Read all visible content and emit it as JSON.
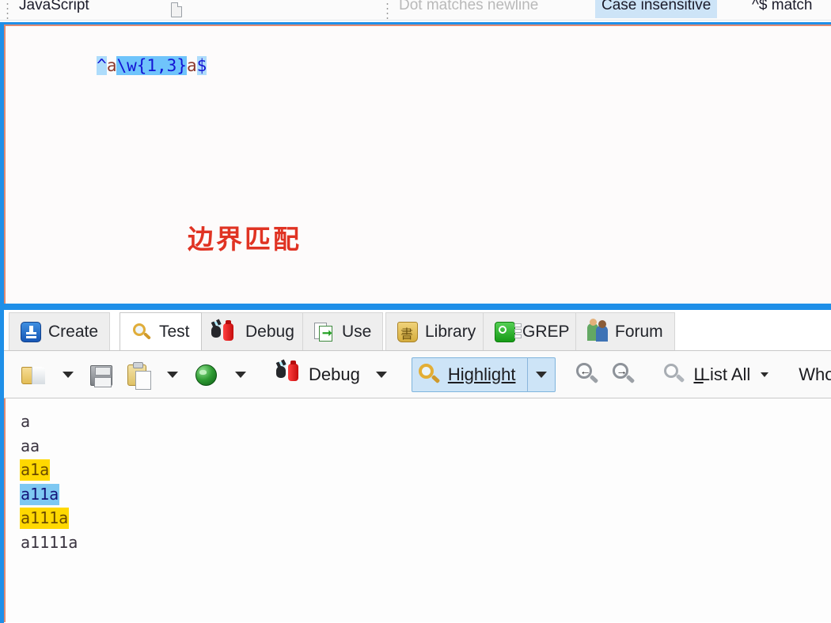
{
  "top_options_bar": {
    "flavor_label": "JavaScript",
    "page_icon_name": "page-icon",
    "options": [
      {
        "label": "Dot matches newline",
        "state": "disabled"
      },
      {
        "label": "Case insensitive",
        "state": "active"
      },
      {
        "label": "^$ match",
        "state": "normal"
      }
    ]
  },
  "regex_editor": {
    "tokens": [
      {
        "text": "^",
        "kind": "anchor"
      },
      {
        "text": "a",
        "kind": "literal"
      },
      {
        "text": "\\w{1,3}",
        "kind": "class"
      },
      {
        "text": "a",
        "kind": "literal"
      },
      {
        "text": "$",
        "kind": "anchor"
      }
    ],
    "full_pattern": "^a\\w{1,3}a$",
    "annotation": "边界匹配",
    "annotation_color": "#e03323"
  },
  "tabs": [
    {
      "label": "Create",
      "icon": "create-icon",
      "active": false
    },
    {
      "label": "Test",
      "icon": "magnifier-icon",
      "active": true
    },
    {
      "label": "Debug",
      "icon": "debug-bug-icon",
      "active": false
    },
    {
      "label": "Use",
      "icon": "use-page-icon",
      "active": false
    },
    {
      "label": "Library",
      "icon": "library-icon",
      "active": false
    },
    {
      "label": "GREP",
      "icon": "grep-icon",
      "active": false
    },
    {
      "label": "Forum",
      "icon": "forum-people-icon",
      "active": false
    }
  ],
  "toolbar": {
    "open_label": "",
    "save_label": "",
    "paste_label": "",
    "browser_label": "",
    "debug_label": "Debug",
    "highlight_label": "Highlight",
    "highlight_active": true,
    "find_prev_label": "",
    "find_next_label": "",
    "list_all_label": "List All",
    "whole_file_label": "Whole file",
    "icons": {
      "open": "open-folder-icon",
      "save": "floppy-save-icon",
      "paste": "clipboard-paste-icon",
      "browser": "globe-icon",
      "debug": "debug-bug-icon",
      "highlight": "magnifier-gold-icon",
      "find_prev": "magnifier-left-arrow-icon",
      "find_next": "magnifier-right-arrow-icon",
      "list_all": "magnifier-gray-icon",
      "dropdown": "chevron-down-icon"
    }
  },
  "test_subject": {
    "lines": [
      {
        "text": "a",
        "highlight": "none"
      },
      {
        "text": "aa",
        "highlight": "none"
      },
      {
        "text": "a1a",
        "highlight": "yellow"
      },
      {
        "text": "a11a",
        "highlight": "blue"
      },
      {
        "text": "a111a",
        "highlight": "yellow"
      },
      {
        "text": "a1111a",
        "highlight": "none"
      }
    ]
  },
  "colors": {
    "panel_border_blue": "#1e8fe8",
    "editor_border_salmon": "#e08a72",
    "match_yellow": "#ffd800",
    "match_blue": "#7ec8f2",
    "active_toggle_blue": "#cde4f7"
  }
}
